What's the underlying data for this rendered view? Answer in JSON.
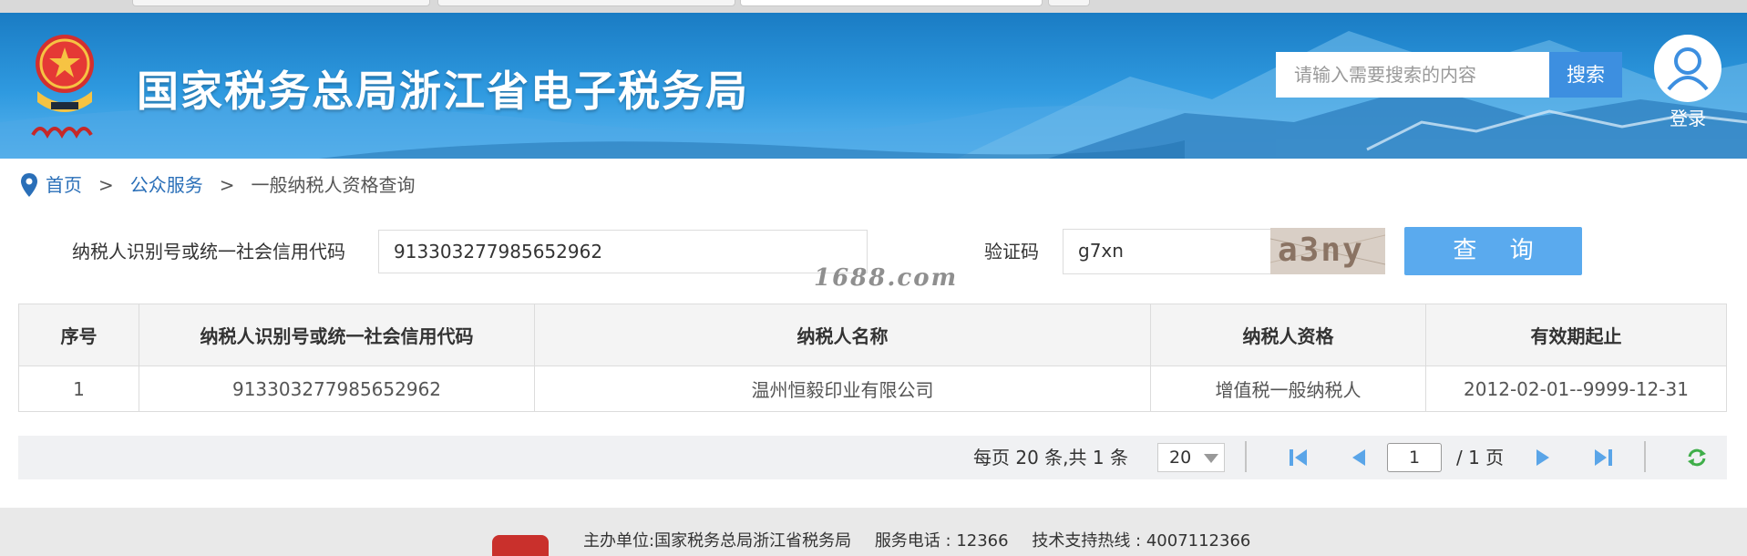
{
  "header": {
    "site_title": "国家税务总局浙江省电子税务局",
    "search": {
      "placeholder": "请输入需要搜索的内容",
      "button_label": "搜索"
    },
    "login_label": "登录"
  },
  "breadcrumb": {
    "items": [
      {
        "label": "首页"
      },
      {
        "label": "公众服务"
      },
      {
        "label": "一般纳税人资格查询"
      }
    ],
    "separator": ">"
  },
  "query_form": {
    "taxpayer_id_label": "纳税人识别号或统一社会信用代码",
    "taxpayer_id_value": "913303277985652962",
    "captcha_label": "验证码",
    "captcha_value": "g7xn",
    "captcha_image_text": "a3ny",
    "query_button_label": "查 询"
  },
  "watermark": "1688.com",
  "results_table": {
    "columns": [
      "序号",
      "纳税人识别号或统一社会信用代码",
      "纳税人名称",
      "纳税人资格",
      "有效期起止"
    ],
    "rows": [
      [
        "1",
        "913303277985652962",
        "温州恒毅印业有限公司",
        "增值税一般纳税人",
        "2012-02-01--9999-12-31"
      ]
    ]
  },
  "pagination": {
    "summary": "每页 20 条,共 1 条",
    "page_size": "20",
    "current_page": "1",
    "total_pages": "/ 1 页"
  },
  "footer": {
    "host": "主办单位:国家税务总局浙江省税务局",
    "phone": "服务电话 : 12366",
    "support": "技术支持热线 : 4007112366"
  },
  "colors": {
    "header_blue": "#2f9ae0",
    "link_blue": "#2a6fb8",
    "query_button": "#5aaaee",
    "search_button": "#3d8fe0",
    "pager_icon_blue": "#5aa5e8",
    "refresh_green": "#3fae49"
  }
}
